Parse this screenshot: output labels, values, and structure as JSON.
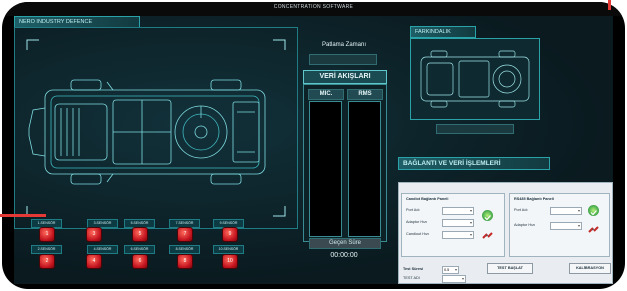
{
  "window": {
    "title": "CONCENTRATION SOFTWARE"
  },
  "left_panel": {
    "title": "NERO INDUSTRY DEFENCE"
  },
  "sensors": [
    {
      "label": "1.SENSÖR",
      "index": "1"
    },
    {
      "label": "3.SENSÖR",
      "index": "3"
    },
    {
      "label": "5.SENSÖR",
      "index": "5"
    },
    {
      "label": "7.SENSÖR",
      "index": "7"
    },
    {
      "label": "9.SENSÖR",
      "index": "9"
    },
    {
      "label": "2.SENSÖR",
      "index": "2"
    },
    {
      "label": "4.SENSÖR",
      "index": "4"
    },
    {
      "label": "6.SENSÖR",
      "index": "6"
    },
    {
      "label": "8.SENSÖR",
      "index": "8"
    },
    {
      "label": "10.SENSÖR",
      "index": "10"
    }
  ],
  "center": {
    "explosion_time_label": "Patlama Zamanı",
    "data_streams_title": "VERİ AKIŞLARI",
    "mic_label": "MIC.",
    "rms_label": "RMS",
    "elapsed_label": "Geçen Süre",
    "elapsed_value": "00:00:00"
  },
  "right_panel": {
    "awareness_title": "FARKINDALIK",
    "connection_title": "BAĞLANTI VE VERİ İŞLEMLERİ",
    "candiot_panel": {
      "title": "Candiot Bağlantı Paneli",
      "port_label": "Port Adı",
      "adapter_label": "Adaptor Hızı",
      "candiot_speed_label": "Candiout Hızı"
    },
    "rs485_panel": {
      "title": "RS485 Bağlantı Paneli",
      "port_label": "Port Adı",
      "adapter_label": "Adaptor Hızı"
    },
    "test_duration_label": "Test Süresi",
    "test_duration_value": "0.5",
    "test_name_label": "TEST ADI",
    "start_test_button": "TEST BAŞLAT",
    "calibration_button": "KALİBRASYON"
  },
  "colors": {
    "accent": "#2aa3a8",
    "sensor_red": "#d32f2f",
    "background": "#0a1a1f"
  }
}
